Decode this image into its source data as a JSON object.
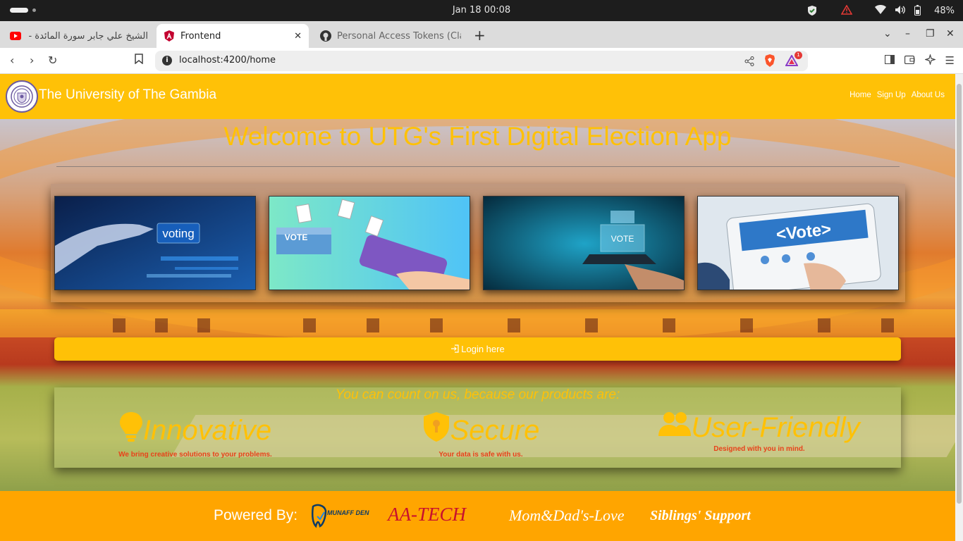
{
  "os": {
    "clock": "Jan 18  00:08",
    "battery": "48%"
  },
  "browser": {
    "tabs": [
      {
        "title": "الشيخ علي جابر سورة المائدة - e",
        "favicon": "youtube-icon",
        "active": false
      },
      {
        "title": "Frontend",
        "favicon": "angular-icon",
        "active": true
      },
      {
        "title": "Personal Access Tokens (Cla",
        "favicon": "github-icon",
        "active": false
      }
    ],
    "url": "localhost:4200/home"
  },
  "site": {
    "brand": "The University of The Gambia",
    "menu": [
      "Home",
      "Sign Up",
      "About Us"
    ],
    "title": "Welcome to UTG's First Digital Election App",
    "cards": [
      {
        "label": "voting",
        "icon": "digital-voting-hand-icon"
      },
      {
        "label": "VOTE",
        "icon": "ballot-box-phone-icon"
      },
      {
        "label": "VOTE",
        "icon": "phone-ballot-hologram-icon"
      },
      {
        "label": "<Vote>",
        "icon": "tablet-vote-icon"
      }
    ],
    "login": "Login here",
    "features_heading": "You can count on us, because our products are:",
    "features": [
      {
        "title": "Innovative",
        "desc": "We bring creative solutions to your problems.",
        "icon": "lightbulb-icon"
      },
      {
        "title": "Secure",
        "desc": "Your data is safe with us.",
        "icon": "shield-icon"
      },
      {
        "title": "User-Friendly",
        "desc": "Designed with you in mind.",
        "icon": "users-icon"
      }
    ],
    "footer": {
      "powered": "Powered By:",
      "sponsors": [
        "MUNAFF DENTAL CLINIC",
        "AA-TECH",
        "Mom&Dad's-Love",
        "Siblings' Support"
      ]
    }
  },
  "colors": {
    "primary": "#ffc107",
    "footer": "#ffa500",
    "accent": "#e8421a"
  }
}
